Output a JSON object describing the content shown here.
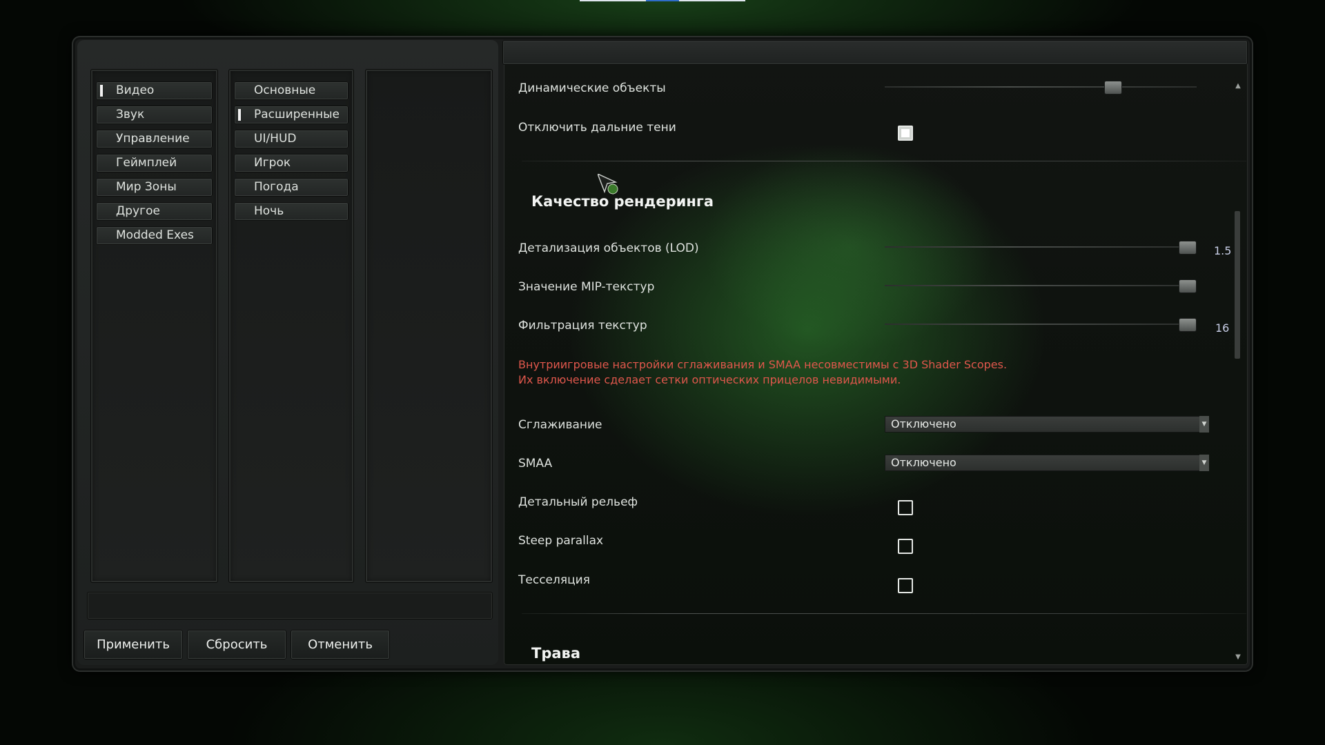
{
  "left_tabs": [
    {
      "label": "Видео",
      "active": true
    },
    {
      "label": "Звук",
      "active": false
    },
    {
      "label": "Управление",
      "active": false
    },
    {
      "label": "Геймплей",
      "active": false
    },
    {
      "label": "Мир Зоны",
      "active": false
    },
    {
      "label": "Другое",
      "active": false
    },
    {
      "label": "Modded Exes",
      "active": false
    }
  ],
  "sub_tabs": [
    {
      "label": "Основные",
      "active": false
    },
    {
      "label": "Расширенные",
      "active": true
    },
    {
      "label": "UI/HUD",
      "active": false
    },
    {
      "label": "Игрок",
      "active": false
    },
    {
      "label": "Погода",
      "active": false
    },
    {
      "label": "Ночь",
      "active": false
    }
  ],
  "buttons": {
    "apply": "Применить",
    "reset": "Сбросить",
    "cancel": "Отменить"
  },
  "settings": {
    "dynamic_objects": {
      "label": "Динамические объекты",
      "level": 0.73
    },
    "disable_far_shadows": {
      "label": "Отключить дальние тени",
      "checked": true
    },
    "section_render": "Качество рендеринга",
    "lod": {
      "label": "Детализация объектов (LOD)",
      "value": "1.5",
      "level": 0.97
    },
    "mip": {
      "label": "Значение MIP-текстур",
      "level": 0.97
    },
    "filtering": {
      "label": "Фильтрация текстур",
      "value": "16",
      "level": 0.97
    },
    "warning_line1": "Внутриигровые настройки сглаживания и SMAA несовместимы с 3D Shader Scopes.",
    "warning_line2": "Их включение сделает сетки оптических прицелов невидимыми.",
    "antialiasing": {
      "label": "Сглаживание",
      "value": "Отключено"
    },
    "smaa": {
      "label": "SMAA",
      "value": "Отключено"
    },
    "detail_relief": {
      "label": "Детальный рельеф",
      "checked": false
    },
    "steep_parallax": {
      "label": "Steep parallax",
      "checked": false
    },
    "tessellation": {
      "label": "Тесселяция",
      "checked": false
    },
    "section_grass": "Трава"
  },
  "colors": {
    "warning": "#e0574c",
    "value_text": "#c9cfe8",
    "accent_green": "#2e8a2e"
  },
  "icons": {
    "scroll_up": "▲",
    "scroll_down": "▼",
    "dropdown": "▼"
  }
}
